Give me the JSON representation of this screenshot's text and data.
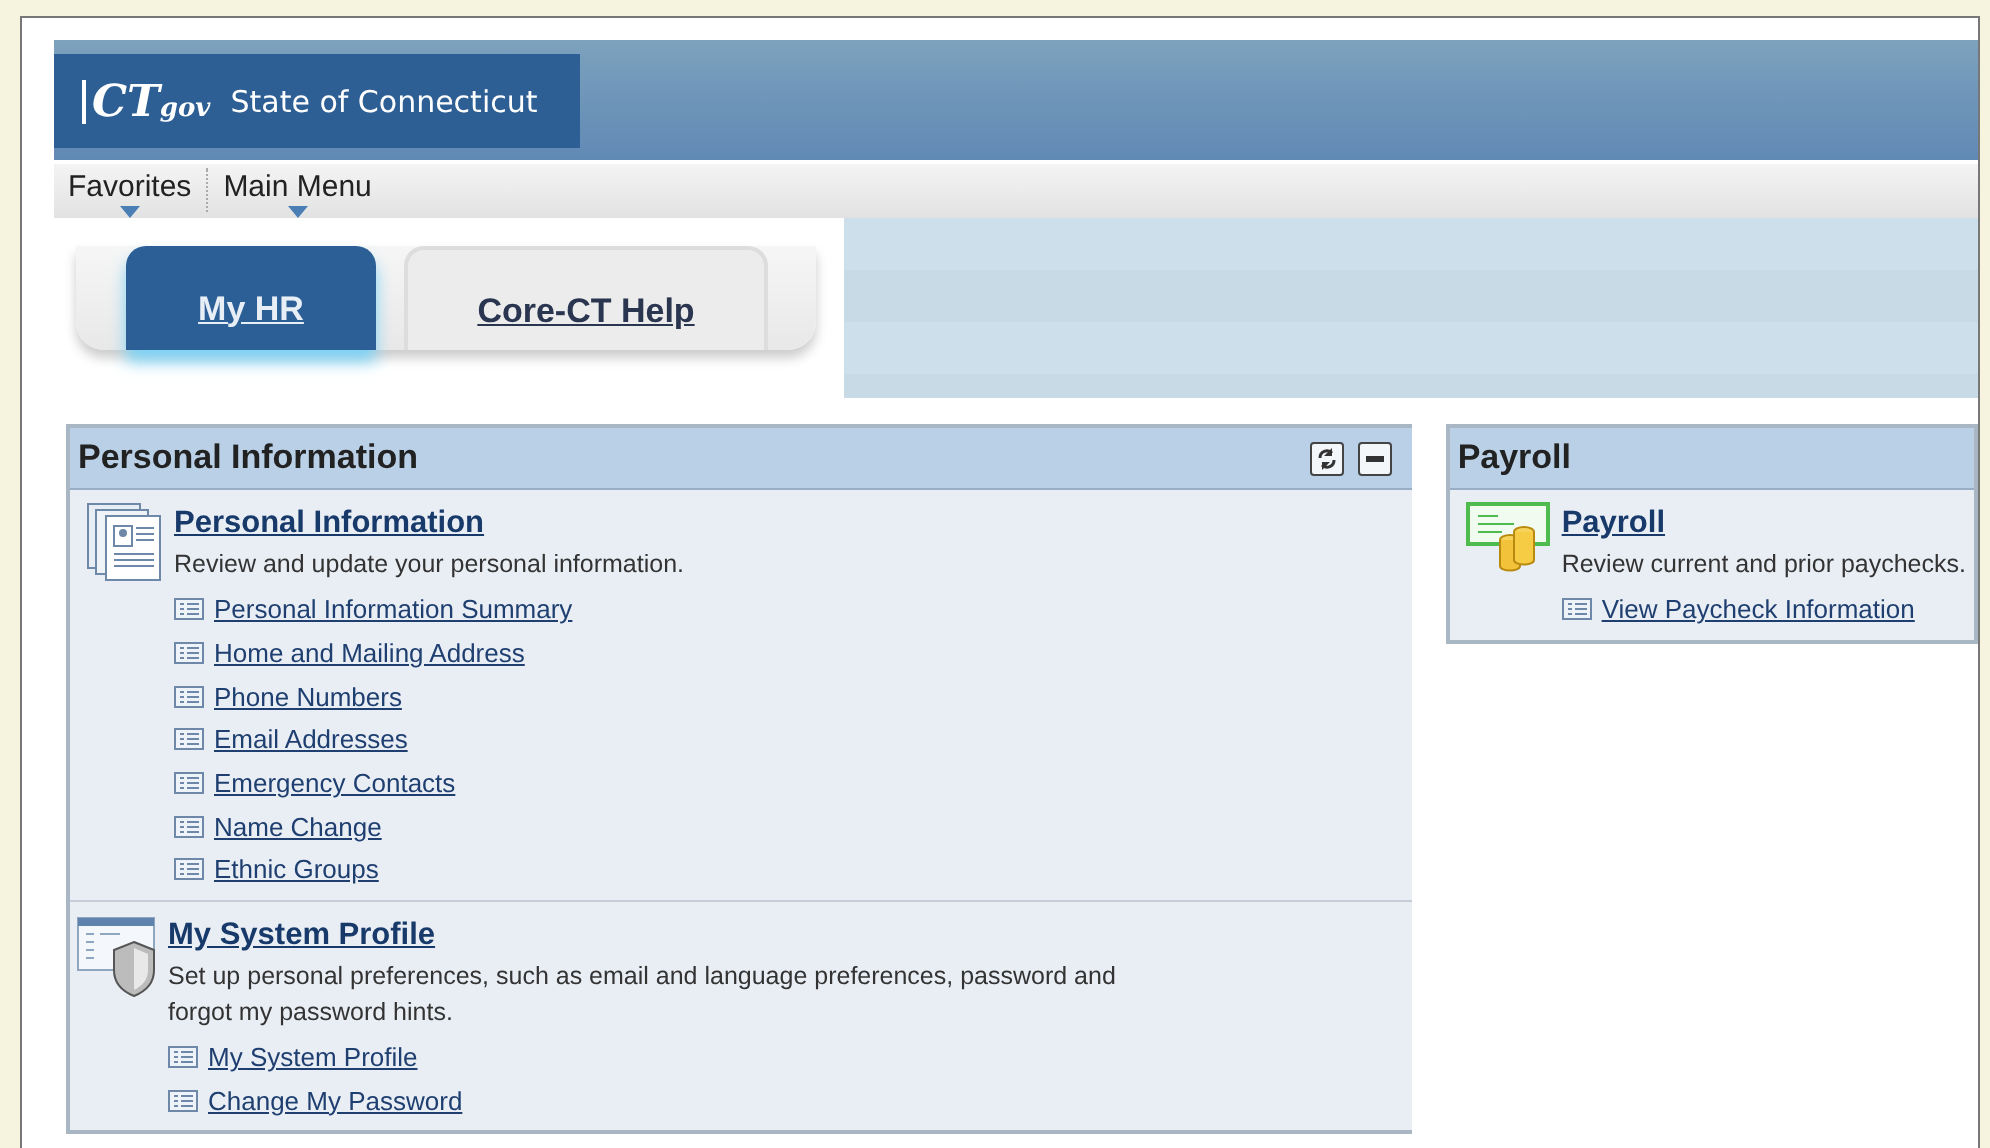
{
  "header": {
    "logo": {
      "mark": "CT",
      "suffix": "gov"
    },
    "title": "State of Connecticut"
  },
  "menu": [
    {
      "label": "Favorites"
    },
    {
      "label": "Main Menu"
    }
  ],
  "tabs": [
    {
      "label": "My HR",
      "selected": true
    },
    {
      "label": "Core-CT Help",
      "selected": false
    }
  ],
  "pagelets": [
    {
      "title": "Personal Information",
      "controls": true,
      "sections": [
        {
          "kind": "person",
          "title": "Personal Information",
          "description": "Review and update your personal information.",
          "links": [
            "Personal Information Summary",
            "Home and Mailing Address",
            "Phone Numbers",
            "Email Addresses",
            "Emergency Contacts",
            "Name Change",
            "Ethnic Groups"
          ]
        },
        {
          "kind": "shield",
          "title": "My System Profile",
          "description": "Set up personal preferences, such as email and language preferences, password and forgot my password hints.",
          "links": [
            "My System Profile",
            "Change My Password"
          ]
        }
      ]
    },
    {
      "title": "Payroll",
      "controls": false,
      "sections": [
        {
          "kind": "paycheck",
          "title": "Payroll",
          "description": "Review current and prior paychecks.",
          "links": [
            "View Paycheck Information"
          ]
        }
      ]
    }
  ]
}
